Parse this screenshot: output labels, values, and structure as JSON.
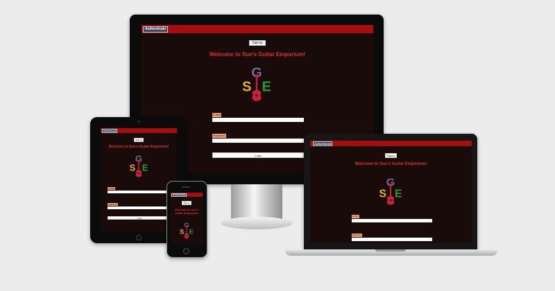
{
  "header": {
    "auth_label": "Authenticate"
  },
  "actions": {
    "signup_label": "Signup",
    "login_label": "Login"
  },
  "welcome": {
    "title": "Welcome to Sue's Guitar Emporium!",
    "line1": "Welcome to Sue's",
    "line2": "Guitar Emporium!"
  },
  "logo": {
    "letters": {
      "top": "G",
      "left": "S",
      "right": "E"
    },
    "colors": {
      "g": "#6c6a8e",
      "s": "#e2b31c",
      "e": "#2d9a2a",
      "guitar": "#c8213a"
    },
    "name": "guitar-logo"
  },
  "form": {
    "email_label": "E-Mail",
    "password_label": "Password"
  },
  "colors": {
    "bar": "#a80d0d",
    "screen": "#1a0b0b",
    "label_bg": "#f2a36a",
    "welcome": "#e0302f"
  }
}
